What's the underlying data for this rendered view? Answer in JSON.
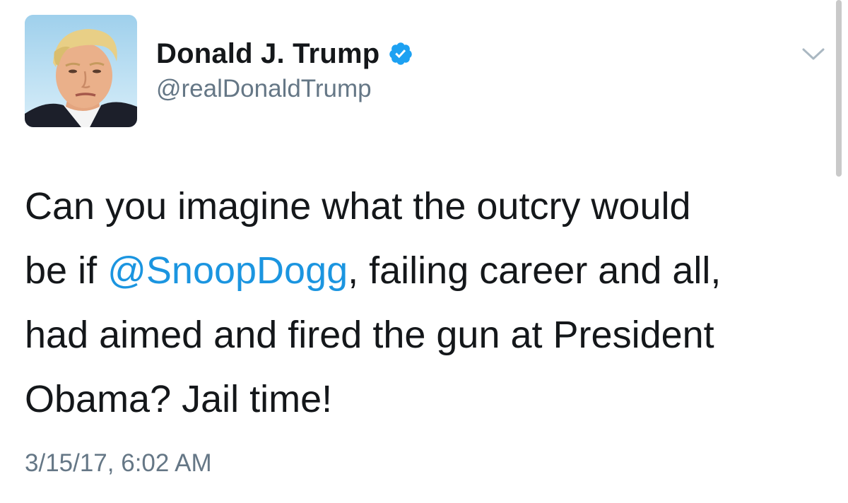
{
  "tweet": {
    "author": {
      "display_name": "Donald J. Trump",
      "handle": "@realDonaldTrump",
      "verified": true,
      "verified_icon": "verified-badge-icon",
      "avatar_icon": "profile-photo"
    },
    "menu_icon": "chevron-down-icon",
    "text": {
      "part1": "Can you imagine what the outcry would\nbe if ",
      "mention": "@SnoopDogg",
      "part2": ", failing career and all,\nhad aimed and fired the gun at President\nObama? Jail time!"
    },
    "timestamp": "3/15/17, 6:02 AM"
  },
  "colors": {
    "text": "#14171a",
    "secondary": "#657786",
    "link": "#1b95e0",
    "verified": "#1da1f2",
    "caret": "#aab8c2"
  }
}
